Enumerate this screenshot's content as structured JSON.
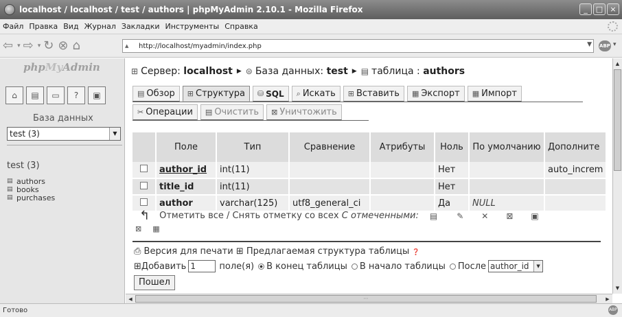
{
  "window": {
    "title": "localhost / localhost / test / authors | phpMyAdmin 2.10.1 - Mozilla Firefox",
    "buttons": [
      "_",
      "□",
      "×"
    ]
  },
  "menu": [
    "Файл",
    "Правка",
    "Вид",
    "Журнал",
    "Закладки",
    "Инструменты",
    "Справка"
  ],
  "nav": {
    "url": "http://localhost/myadmin/index.php",
    "adblock": "ABP"
  },
  "sidebar": {
    "logo_php": "php",
    "logo_my": "My",
    "logo_admin": "Admin",
    "db_caption": "База данных",
    "db_selected": "test (3)",
    "db_name": "test (3)",
    "tables": [
      "authors",
      "books",
      "purchases"
    ]
  },
  "breadcrumb": {
    "server_label": "Сервер:",
    "server": "localhost",
    "db_label": "База данных:",
    "db": "test",
    "table_label": "таблица :",
    "table": "authors"
  },
  "tabs_row1": [
    "Обзор",
    "Структура",
    "SQL",
    "Искать",
    "Вставить",
    "Экспорт",
    "Импорт"
  ],
  "tabs_row2": [
    "Операции",
    "Очистить",
    "Уничтожить"
  ],
  "table": {
    "headers": [
      "Поле",
      "Тип",
      "Сравнение",
      "Атрибуты",
      "Ноль",
      "По умолчанию",
      "Дополните"
    ],
    "rows": [
      {
        "field": "author_id",
        "type": "int(11)",
        "collation": "",
        "attributes": "",
        "null": "Нет",
        "default": "",
        "extra": "auto_increm"
      },
      {
        "field": "title_id",
        "type": "int(11)",
        "collation": "",
        "attributes": "",
        "null": "Нет",
        "default": "",
        "extra": ""
      },
      {
        "field": "author",
        "type": "varchar(125)",
        "collation": "utf8_general_ci",
        "attributes": "",
        "null": "Да",
        "default": "NULL",
        "extra": ""
      }
    ]
  },
  "checkall": {
    "text": "Отметить все / Снять отметку со всех",
    "with_selected": "С отмеченными:"
  },
  "footer": {
    "print_version": "Версия для печати",
    "propose_structure": "Предлагаемая структура таблицы",
    "add_label": "Добавить",
    "add_count": "1",
    "fields_label": "поле(я)",
    "at_end": "В конец таблицы",
    "at_begin": "В начало таблицы",
    "after": "После",
    "after_field": "author_id",
    "go": "Пошел"
  },
  "status": "Готово"
}
